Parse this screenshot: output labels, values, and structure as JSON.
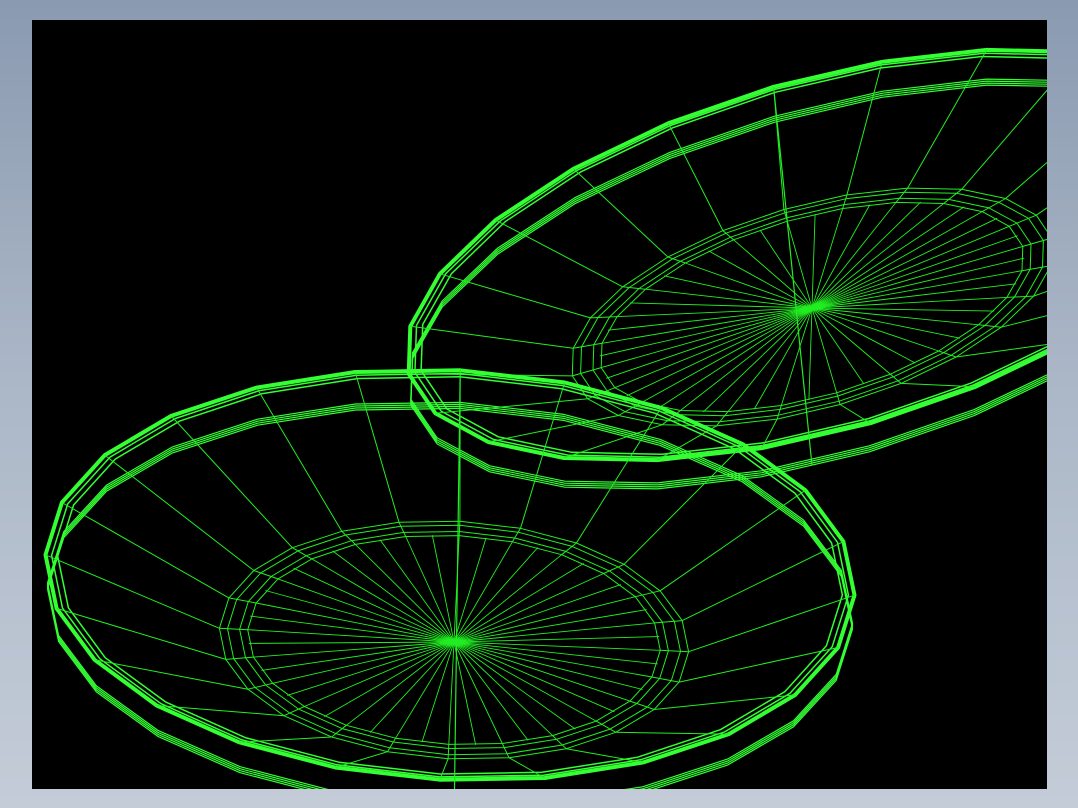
{
  "app": {
    "title": ""
  },
  "viewport": {
    "background": "#000000",
    "wire_color": "#22ee22",
    "rim_color": "#33ff33",
    "frame_gradient": [
      "#8a9ab0",
      "#c4ccd8"
    ],
    "display_mode": "wireframe"
  },
  "scene": {
    "objects": [
      {
        "name": "dish-upper-right",
        "type": "shallow-dish"
      },
      {
        "name": "dish-lower-left",
        "type": "shallow-dish"
      }
    ]
  }
}
